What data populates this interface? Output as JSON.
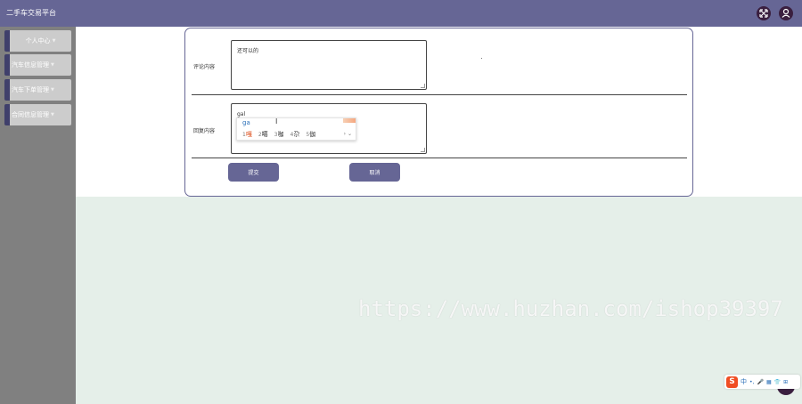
{
  "header": {
    "title": "二手车交易平台",
    "expand_icon": "expand-icon",
    "user_icon": "user-icon"
  },
  "sidebar": {
    "items": [
      {
        "label": "个人中心"
      },
      {
        "label": "汽车信息管理"
      },
      {
        "label": "汽车下单管理"
      },
      {
        "label": "合同信息管理"
      }
    ],
    "caret": "▼"
  },
  "form": {
    "comment_label": "评论内容",
    "comment_value": "还可以的",
    "reply_label": "回复内容",
    "reply_value": "gal",
    "submit_label": "提交",
    "cancel_label": "取消"
  },
  "ime_popup": {
    "pinyin": "ga",
    "candidates": [
      {
        "num": "1",
        "text": "嘎"
      },
      {
        "num": "2",
        "text": "噶"
      },
      {
        "num": "3",
        "text": "咖"
      },
      {
        "num": "4",
        "text": "尕"
      },
      {
        "num": "5",
        "text": "伽"
      }
    ],
    "arrows": "› ⌄"
  },
  "watermark": "https://www.huzhan.com/ishop39397",
  "ime_toolbar": {
    "logo": "S",
    "mode": "中"
  },
  "colors": {
    "topbar": "#666695",
    "sidebar": "#808080",
    "accent": "#666695",
    "background": "#e5efe9"
  }
}
